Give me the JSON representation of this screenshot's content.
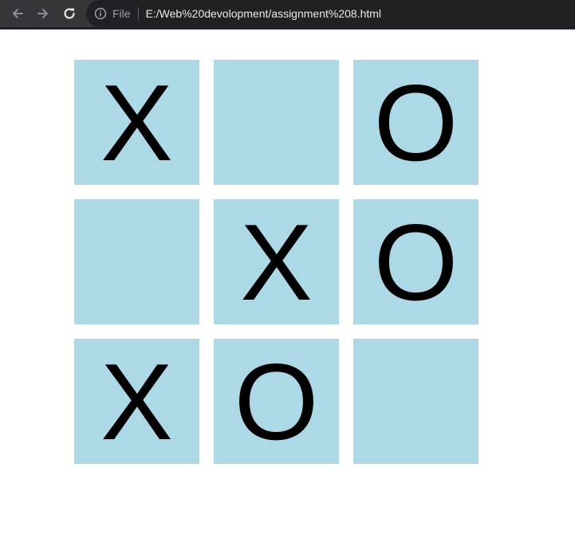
{
  "browser": {
    "back_icon": "arrow-left-icon",
    "forward_icon": "arrow-right-icon",
    "reload_icon": "reload-icon",
    "info_icon": "info-icon",
    "file_label": "File",
    "url": "E:/Web%20devolopment/assignment%208.html",
    "bar_color": "#35363a",
    "omnibox_color": "#202124"
  },
  "board": {
    "cell_color": "#add8e6",
    "mark_color": "#000000",
    "cells": [
      "X",
      "",
      "O",
      "",
      "X",
      "O",
      "X",
      "O",
      ""
    ]
  }
}
